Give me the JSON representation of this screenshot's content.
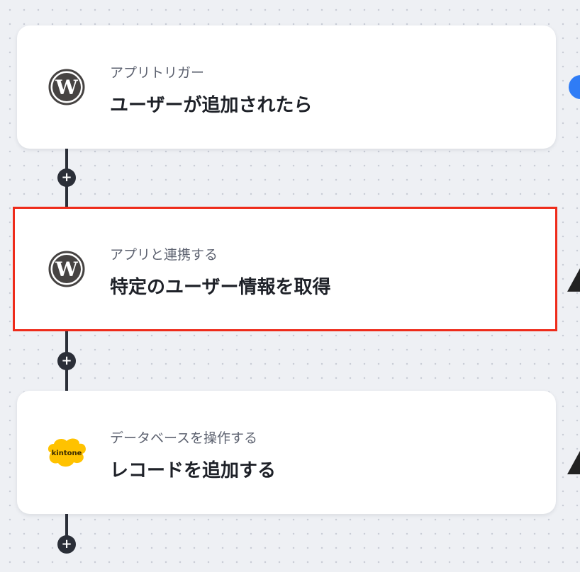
{
  "steps": [
    {
      "app": "WordPress",
      "icon": "wordpress-icon",
      "subtitle": "アプリトリガー",
      "title": "ユーザーが追加されたら"
    },
    {
      "app": "WordPress",
      "icon": "wordpress-icon",
      "subtitle": "アプリと連携する",
      "title": "特定のユーザー情報を取得",
      "selected": true
    },
    {
      "app": "kintone",
      "icon": "kintone-icon",
      "logo_text": "kintone",
      "subtitle": "データベースを操作する",
      "title": "レコードを追加する"
    }
  ],
  "add_button_glyph": "+",
  "colors": {
    "selection_border": "#ee2b1a",
    "connector": "#2b2f38",
    "status_blue": "#2f7cf6",
    "kintone_yellow": "#ffc200",
    "wordpress_gray": "#464342"
  }
}
